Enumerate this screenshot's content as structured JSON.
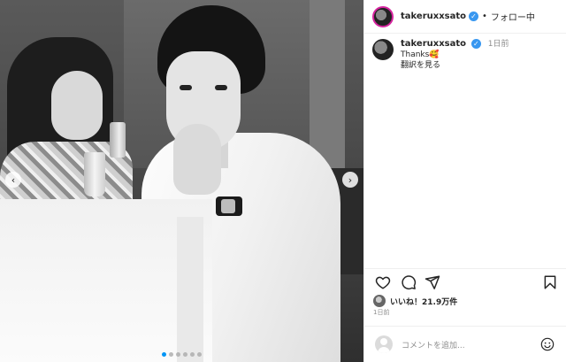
{
  "post": {
    "username": "takeruxxsato",
    "separator": "•",
    "follow_label": "フォロー中",
    "caption_text": "Thanks🥰",
    "caption_time": "1日前",
    "translate_label": "翻訳を見る",
    "likes_label": "いいね！21.9万件",
    "time_ago": "1日前",
    "comment_placeholder": "コメントを追加..."
  },
  "carousel": {
    "prev_icon": "chevron-left-icon",
    "next_icon": "chevron-right-icon",
    "prev_glyph": "‹",
    "next_glyph": "›",
    "dot_count": 6,
    "active_index": 0
  },
  "colors": {
    "verified": "#3897f0",
    "story_ring": "#d6249f",
    "active_dot": "#0095f6",
    "secondary_text": "#8e8e8e"
  },
  "icons": {
    "like": "heart-icon",
    "comment": "comment-icon",
    "share": "paper-plane-icon",
    "save": "bookmark-icon",
    "emoji": "smiley-icon",
    "verified": "verified-badge-icon"
  }
}
